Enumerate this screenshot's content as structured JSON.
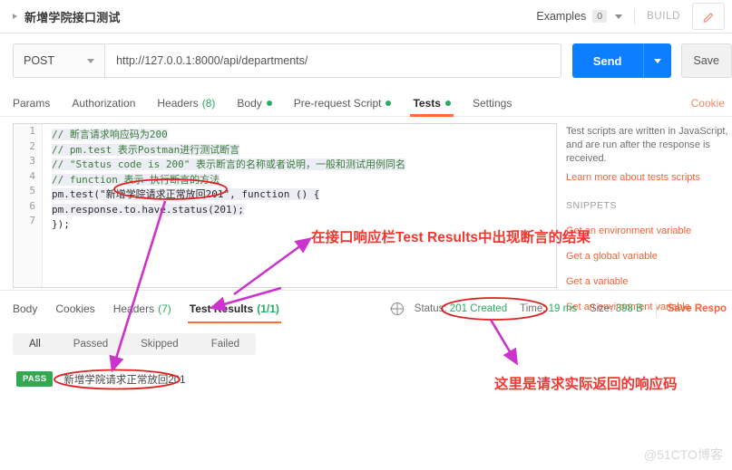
{
  "window": {
    "request_title": "新增学院接口测试",
    "examples_label": "Examples",
    "examples_count": "0",
    "build_label": "BUILD",
    "edit_icon": "pencil-icon"
  },
  "request": {
    "method": "POST",
    "url": "http://127.0.0.1:8000/api/departments/",
    "send_label": "Send",
    "save_label": "Save",
    "tabs": [
      {
        "label": "Params",
        "dot": false,
        "count": "",
        "active": false
      },
      {
        "label": "Authorization",
        "dot": false,
        "count": "",
        "active": false
      },
      {
        "label": "Headers",
        "dot": false,
        "count": "(8)",
        "active": false
      },
      {
        "label": "Body",
        "dot": true,
        "count": "",
        "active": false
      },
      {
        "label": "Pre-request Script",
        "dot": true,
        "count": "",
        "active": false
      },
      {
        "label": "Tests",
        "dot": true,
        "count": "",
        "active": true
      },
      {
        "label": "Settings",
        "dot": false,
        "count": "",
        "active": false
      }
    ],
    "cookie_link": "Cookie"
  },
  "editor": {
    "line_numbers": [
      "1",
      "2",
      "3",
      "4",
      "5",
      "6",
      "7"
    ],
    "lines": [
      "// 断言请求响应码为200",
      "// pm.test 表示Postman进行测试断言",
      "// \"Status code is 200\" 表示断言的名称或者说明，一般和测试用例同名",
      "// function 表示 执行断言的方法",
      "pm.test(\"新增学院请求正常放回201\", function () {",
      "    pm.response.to.have.status(201);",
      "});"
    ]
  },
  "snippets": {
    "description": "Test scripts are written in JavaScript, and are run after the response is received.",
    "learn_more": "Learn more about tests scripts",
    "heading": "SNIPPETS",
    "items": [
      "Get an environment variable",
      "Get a global variable",
      "Get a variable",
      "Set an environment variable"
    ]
  },
  "response": {
    "tabs": [
      {
        "label": "Body",
        "count": "",
        "active": false
      },
      {
        "label": "Cookies",
        "count": "",
        "active": false
      },
      {
        "label": "Headers",
        "count": "(7)",
        "active": false
      },
      {
        "label": "Test Results",
        "count": "(1/1)",
        "active": true
      }
    ],
    "status_label": "Status:",
    "status_value": "201 Created",
    "time_label": "Time:",
    "time_value": "19 ms",
    "size_label": "Size:",
    "size_value": "398 B",
    "save_response": "Save Respo",
    "filters": [
      {
        "label": "All",
        "active": true
      },
      {
        "label": "Passed",
        "active": false
      },
      {
        "label": "Skipped",
        "active": false
      },
      {
        "label": "Failed",
        "active": false
      }
    ],
    "results": [
      {
        "badge": "PASS",
        "name": "新增学院请求正常放回201"
      }
    ]
  },
  "annotations": {
    "note_1": "在接口响应栏Test Results中出现断言的结果",
    "note_2": "这里是请求实际返回的响应码"
  },
  "watermark": "@51CTO博客",
  "colors": {
    "accent_orange": "#ff6c37",
    "send_blue": "#0d7eff",
    "pass_green": "#32a852",
    "annotation_red": "#f4362e",
    "arrow_magenta": "#cc33cc"
  }
}
